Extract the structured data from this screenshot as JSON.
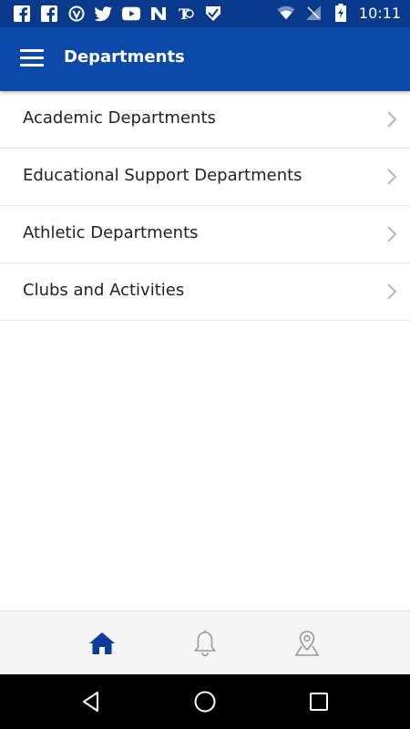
{
  "status_bar": {
    "time": "10:11",
    "left_icons": [
      "facebook-icon",
      "facebook-icon",
      "vpn-icon",
      "twitter-icon",
      "youtube-icon",
      "news-n-icon",
      "nytimes-icon",
      "shield-check-icon"
    ],
    "right_icons": [
      "wifi-icon",
      "signal-icon",
      "battery-charging-icon"
    ]
  },
  "app_bar": {
    "title": "Departments",
    "menu_icon": "hamburger-menu-icon",
    "color": "#0b4aa8"
  },
  "list": {
    "items": [
      {
        "label": "Academic Departments"
      },
      {
        "label": "Educational Support Departments"
      },
      {
        "label": "Athletic Departments"
      },
      {
        "label": "Clubs and Activities"
      }
    ]
  },
  "bottom_nav": {
    "items": [
      {
        "icon": "home-icon",
        "active": true
      },
      {
        "icon": "bell-icon",
        "active": false
      },
      {
        "icon": "map-pin-icon",
        "active": false
      }
    ],
    "active_color": "#0b3c9c",
    "inactive_color": "#999999"
  },
  "system_nav": [
    "back-icon",
    "home-circle-icon",
    "recents-icon"
  ]
}
